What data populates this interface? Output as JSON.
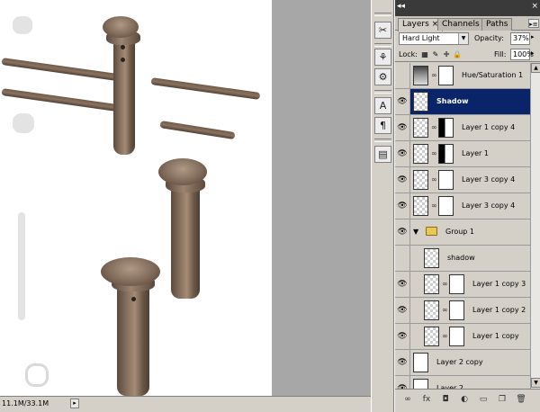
{
  "status_bar": {
    "doc_size": "11.1M/33.1M",
    "arrow": "▸"
  },
  "tool_strip": {
    "tools": [
      {
        "name": "tool-presets-icon",
        "glyph": "✂"
      },
      {
        "name": "brushes-icon",
        "glyph": "⚘"
      },
      {
        "name": "character-icon",
        "glyph": "A"
      },
      {
        "name": "paragraph-icon",
        "glyph": "¶"
      },
      {
        "name": "notes-icon",
        "glyph": "▤"
      }
    ]
  },
  "panel": {
    "top_arrows": "◂◂",
    "close": "×",
    "tabs": [
      {
        "label": "Layers ×",
        "active": true
      },
      {
        "label": "Channels",
        "active": false
      },
      {
        "label": "Paths",
        "active": false
      }
    ],
    "menu_button": "▸≡",
    "blend_mode": "Hard Light",
    "opacity_label": "Opacity:",
    "opacity_value": "37%",
    "lock_label": "Lock:",
    "fill_label": "Fill:",
    "fill_value": "100%",
    "layers": [
      {
        "name": "Hue/Saturation 1",
        "type": "adjustment",
        "visible": false,
        "selected": false,
        "indent": 0
      },
      {
        "name": "Shadow",
        "type": "pixel",
        "visible": true,
        "selected": true,
        "indent": 0
      },
      {
        "name": "Layer 1 copy 4",
        "type": "masked",
        "visible": true,
        "selected": false,
        "indent": 0,
        "mask": "dark"
      },
      {
        "name": "Layer 1",
        "type": "masked",
        "visible": true,
        "selected": false,
        "indent": 0,
        "mask": "dark"
      },
      {
        "name": "Layer 3 copy 4",
        "type": "masked",
        "visible": true,
        "selected": false,
        "indent": 0,
        "mask": "plain"
      },
      {
        "name": "Layer 3 copy 4",
        "type": "masked",
        "visible": true,
        "selected": false,
        "indent": 0,
        "mask": "plain"
      },
      {
        "name": "Group 1",
        "type": "group",
        "visible": true,
        "selected": false,
        "indent": 0
      },
      {
        "name": "shadow",
        "type": "pixel",
        "visible": false,
        "selected": false,
        "indent": 1
      },
      {
        "name": "Layer 1 copy 3",
        "type": "masked",
        "visible": true,
        "selected": false,
        "indent": 1,
        "mask": "plain"
      },
      {
        "name": "Layer 1 copy 2",
        "type": "masked",
        "visible": true,
        "selected": false,
        "indent": 1,
        "mask": "plain"
      },
      {
        "name": "Layer 1 copy",
        "type": "masked",
        "visible": true,
        "selected": false,
        "indent": 1,
        "mask": "plain"
      },
      {
        "name": "Layer 2 copy",
        "type": "plain",
        "visible": true,
        "selected": false,
        "indent": 0
      },
      {
        "name": "Layer 2",
        "type": "plain",
        "visible": true,
        "selected": false,
        "indent": 0
      }
    ],
    "footer_icons": [
      {
        "name": "link-layers-icon",
        "glyph": "∞"
      },
      {
        "name": "layer-style-icon",
        "glyph": "fx"
      },
      {
        "name": "add-mask-icon",
        "glyph": "◘"
      },
      {
        "name": "adjustment-layer-icon",
        "glyph": "◐"
      },
      {
        "name": "new-group-icon",
        "glyph": "▭"
      },
      {
        "name": "new-layer-icon",
        "glyph": "❐"
      },
      {
        "name": "delete-layer-icon",
        "glyph": "🗑"
      }
    ]
  }
}
